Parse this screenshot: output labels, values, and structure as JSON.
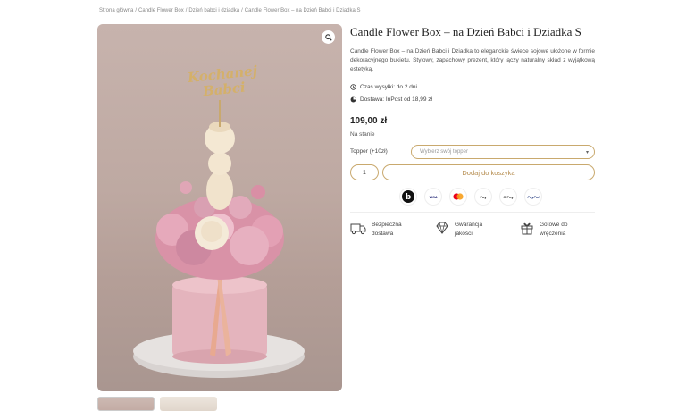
{
  "breadcrumb": {
    "items": [
      "Strona główna",
      "Candle Flower Box",
      "Dzień babci i dziadka",
      "Candle Flower Box – na Dzień Babci i Dziadka S"
    ]
  },
  "product": {
    "title": "Candle Flower Box – na Dzień Babci i Dziadka S",
    "description": "Candle Flower Box – na Dzień Babci i Dziadka to eleganckie świece sojowe ułożone w formie dekoracyjnego bukietu. Stylowy, zapachowy prezent, który łączy naturalny skład z wyjątkową estetyką.",
    "ship_time": "Czas wysyłki: do 2 dni",
    "delivery": "Dostawa: InPost od 18,99 zł",
    "price": "109,00 zł",
    "stock": "Na stanie",
    "topper_label": "Topper (+10zł)",
    "topper_placeholder": "Wybierz swój topper",
    "quantity": "1",
    "add_to_cart": "Dodaj do koszyka",
    "image_topper_text": "Kochanej Babci"
  },
  "payments": [
    "b",
    "VISA",
    "MC",
    "Pay",
    "G Pay",
    "PayPal"
  ],
  "features": [
    {
      "line1": "Bezpieczna",
      "line2": "dostawa"
    },
    {
      "line1": "Gwarancja",
      "line2": "jakości"
    },
    {
      "line1": "Gotowe do",
      "line2": "wręczenia"
    }
  ],
  "colors": {
    "accent": "#c9a96e",
    "accent_text": "#b58c4e"
  }
}
